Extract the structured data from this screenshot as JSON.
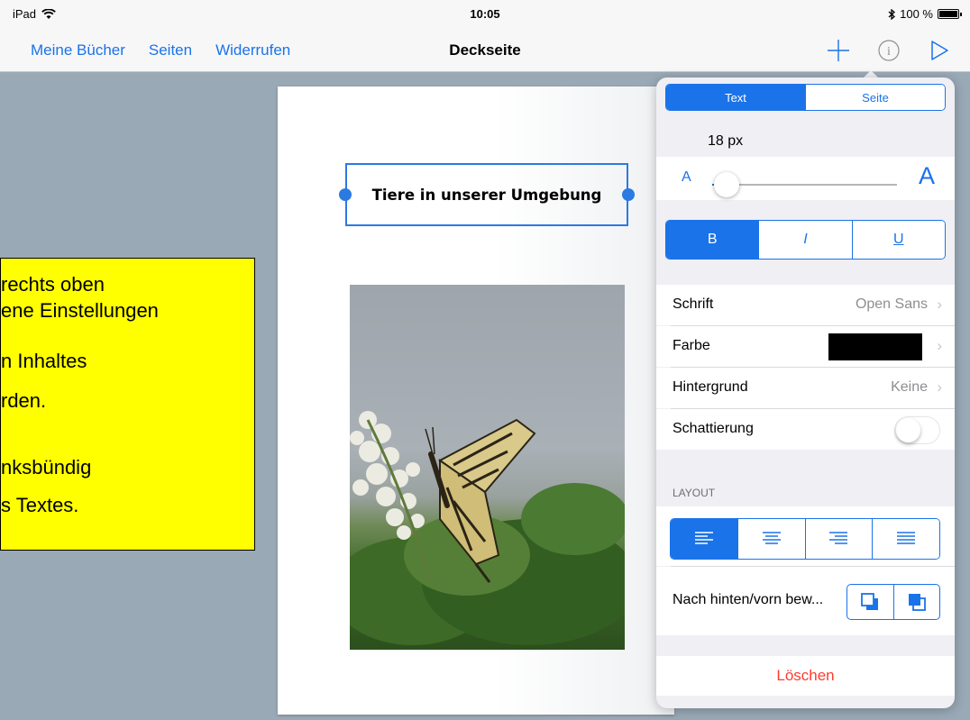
{
  "status_bar": {
    "device": "iPad",
    "time": "10:05",
    "battery": "100 %"
  },
  "nav": {
    "left_buttons": [
      "Meine Bücher",
      "Seiten",
      "Widerrufen"
    ],
    "title": "Deckseite",
    "icons": [
      "plus-icon",
      "info-icon",
      "play-icon"
    ]
  },
  "page": {
    "title_text": "Tiere in unserer Umgebung",
    "image": "butterfly-photo"
  },
  "callout": {
    "lines": [
      "rechts oben",
      "ene Einstellungen",
      "n Inhaltes",
      "rden.",
      "",
      "nksbündig",
      "s Textes."
    ]
  },
  "popover": {
    "tabs": [
      "Text",
      "Seite"
    ],
    "active_tab": "Text",
    "font_size": "18 px",
    "slider_small_label": "A",
    "slider_large_label": "A",
    "slider_level": 0.08,
    "style_buttons": [
      "B",
      "I",
      "U"
    ],
    "active_style": "B",
    "rows": {
      "font": {
        "label": "Schrift",
        "value": "Open Sans"
      },
      "color": {
        "label": "Farbe",
        "swatch": "#000000"
      },
      "background": {
        "label": "Hintergrund",
        "value": "Keine"
      },
      "shadow": {
        "label": "Schattierung",
        "on": false
      }
    },
    "layout_header": "LAYOUT",
    "alignments": [
      "align-left-icon",
      "align-center-icon",
      "align-right-icon",
      "align-justify-icon"
    ],
    "active_alignment": "align-left-icon",
    "arrange_label": "Nach hinten/vorn bew...",
    "delete_label": "Löschen"
  },
  "colors": {
    "accent": "#1a73e8",
    "destructive": "#ff3b30",
    "callout_bg": "#ffff00"
  }
}
